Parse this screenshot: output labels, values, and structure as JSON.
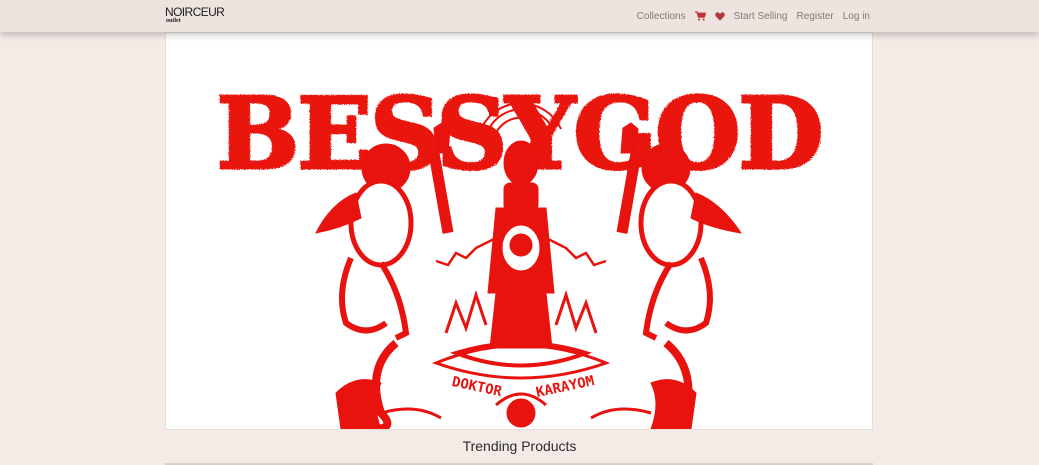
{
  "brand": {
    "logo_main": "NOIRCEUR",
    "logo_sub": "outlet"
  },
  "nav": {
    "collections": "Collections",
    "cart_icon": "shopping-cart-icon",
    "wishlist_icon": "heart-icon",
    "start_selling": "Start Selling",
    "register": "Register",
    "login": "Log in"
  },
  "hero": {
    "artwork_title": "BESSYGOD",
    "artist_left": "DOKTOR",
    "artist_right": "KARAYOM",
    "ink_color": "#e8130f"
  },
  "sections": {
    "trending_title": "Trending Products"
  },
  "colors": {
    "page_bg": "#f4ebe7",
    "nav_bg": "#ede3df",
    "nav_text": "#857a76",
    "cart_icon": "#c4313a",
    "heart_icon": "#b13a3d"
  }
}
